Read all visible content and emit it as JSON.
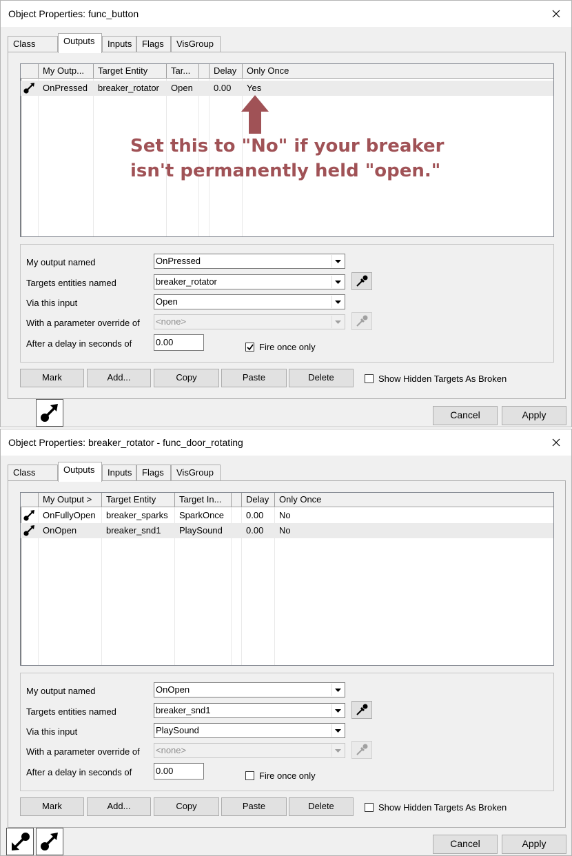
{
  "dialog1": {
    "title": "Object Properties: func_button",
    "tabs": [
      "Class Info",
      "Outputs",
      "Inputs",
      "Flags",
      "VisGroup"
    ],
    "columns": [
      "My Outp...",
      "Target Entity",
      "Tar...",
      "",
      "Delay",
      "Only Once"
    ],
    "rows": [
      {
        "output": "OnPressed",
        "target": "breaker_rotator",
        "input": "Open",
        "param": "",
        "delay": "0.00",
        "once": "Yes"
      }
    ],
    "annotation_line1": "Set this to \"No\" if your breaker",
    "annotation_line2": "isn't permanently held \"open.\"",
    "form": {
      "output_label": "My output named",
      "output_value": "OnPressed",
      "target_label": "Targets entities named",
      "target_value": "breaker_rotator",
      "input_label": "Via this input",
      "input_value": "Open",
      "param_label": "With a parameter override of",
      "param_value": "<none>",
      "delay_label": "After a delay in seconds of",
      "delay_value": "0.00",
      "fire_once_label": "Fire once only",
      "fire_once_checked": true
    },
    "buttons": {
      "mark": "Mark",
      "add": "Add...",
      "copy": "Copy",
      "paste": "Paste",
      "delete": "Delete"
    },
    "show_hidden_label": "Show Hidden Targets As Broken",
    "cancel": "Cancel",
    "apply": "Apply"
  },
  "dialog2": {
    "title": "Object Properties: breaker_rotator - func_door_rotating",
    "tabs": [
      "Class Info",
      "Outputs",
      "Inputs",
      "Flags",
      "VisGroup"
    ],
    "columns": [
      "My Output  >",
      "Target Entity",
      "Target In...",
      "",
      "Delay",
      "Only Once"
    ],
    "rows": [
      {
        "output": "OnFullyOpen",
        "target": "breaker_sparks",
        "input": "SparkOnce",
        "param": "",
        "delay": "0.00",
        "once": "No"
      },
      {
        "output": "OnOpen",
        "target": "breaker_snd1",
        "input": "PlaySound",
        "param": "",
        "delay": "0.00",
        "once": "No"
      }
    ],
    "form": {
      "output_label": "My output named",
      "output_value": "OnOpen",
      "target_label": "Targets entities named",
      "target_value": "breaker_snd1",
      "input_label": "Via this input",
      "input_value": "PlaySound",
      "param_label": "With a parameter override of",
      "param_value": "<none>",
      "delay_label": "After a delay in seconds of",
      "delay_value": "0.00",
      "fire_once_label": "Fire once only",
      "fire_once_checked": false
    },
    "buttons": {
      "mark": "Mark",
      "add": "Add...",
      "copy": "Copy",
      "paste": "Paste",
      "delete": "Delete"
    },
    "show_hidden_label": "Show Hidden Targets As Broken",
    "cancel": "Cancel",
    "apply": "Apply"
  },
  "colors": {
    "annotation": "#a05256",
    "selected_row": "#ebebeb"
  },
  "icons": [
    "close-icon",
    "output-arrow-icon",
    "eyedropper-icon",
    "dropdown-arrow-icon",
    "checkmark-icon",
    "input-arrow-icon"
  ]
}
